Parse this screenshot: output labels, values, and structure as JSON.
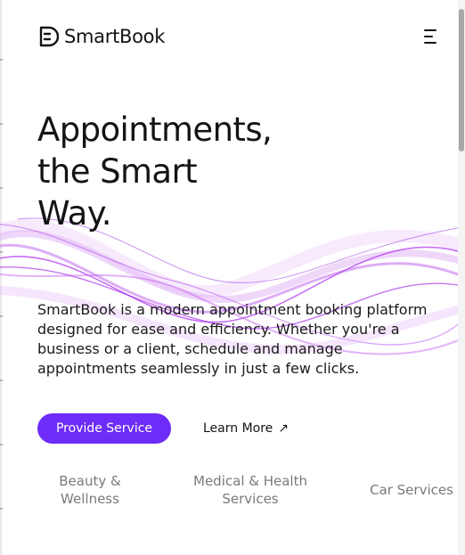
{
  "brand": {
    "name": "SmartBook",
    "logo_icon": "smartbook-logo-icon",
    "menu_icon": "hamburger-menu-icon"
  },
  "hero": {
    "title_lines": [
      "Appointments,",
      "the Smart",
      "Way."
    ],
    "description": "SmartBook is a modern appointment booking platform designed for ease and efficiency. Whether you're a business or a client, schedule and manage appointments seamlessly in just a few clicks."
  },
  "actions": {
    "primary_label": "Provide Service",
    "secondary_label": "Learn More",
    "secondary_icon": "arrow-up-right-icon",
    "secondary_glyph": "↗"
  },
  "categories": [
    {
      "line1": "Beauty &",
      "line2": "Wellness"
    },
    {
      "line1": "Medical & Health",
      "line2": "Services"
    },
    {
      "line1": "Car Services",
      "line2": ""
    }
  ],
  "colors": {
    "accent": "#6d2cf7",
    "text": "#141414",
    "muted_text": "#7a7a7a",
    "ribbon": "#b13ff0"
  }
}
